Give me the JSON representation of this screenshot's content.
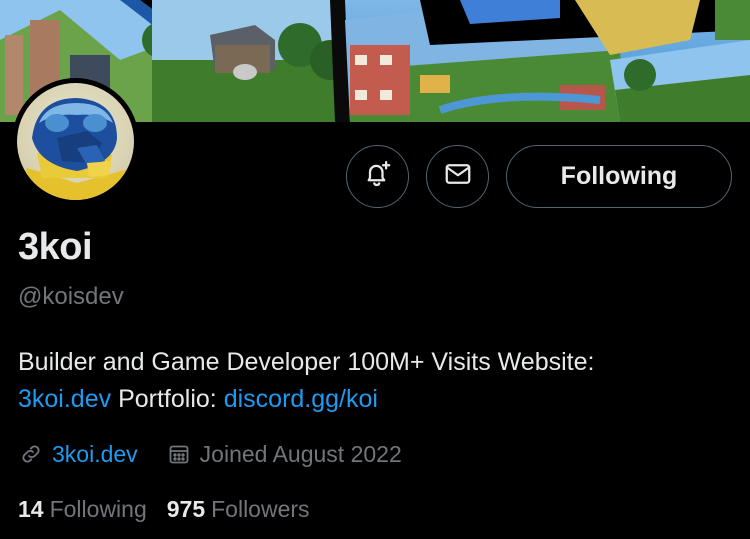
{
  "profile": {
    "display_name": "3koi",
    "handle": "@koisdev",
    "bio": {
      "text_1": "Builder and Game Developer 100M+ Visits Website:",
      "link_1": "3koi.dev",
      "text_2": "Portfolio:",
      "link_2": "discord.gg/koi"
    },
    "meta": {
      "website_icon": "link-icon",
      "website": "3koi.dev",
      "joined_icon": "calendar-icon",
      "joined": "Joined August 2022"
    },
    "stats": {
      "following_count": "14",
      "following_label": "Following",
      "followers_count": "975",
      "followers_label": "Followers"
    }
  },
  "actions": {
    "notify_icon": "bell-plus-icon",
    "message_icon": "envelope-icon",
    "follow_label": "Following"
  },
  "colors": {
    "background": "#000000",
    "text_primary": "#e7e9ea",
    "text_secondary": "#71767b",
    "link": "#1d9bf0",
    "border": "#536471"
  }
}
